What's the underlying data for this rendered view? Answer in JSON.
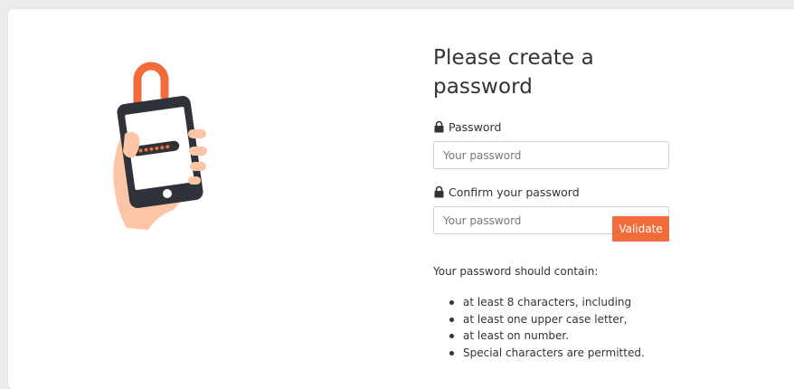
{
  "form": {
    "title": "Please create a password",
    "password_label": "Password",
    "password_placeholder": "Your password",
    "password_value": "",
    "confirm_label": "Confirm your password",
    "confirm_placeholder": "Your password",
    "confirm_value": "",
    "validate_label": "Validate",
    "lock_icon": "lock-icon"
  },
  "requirements": {
    "intro": "Your password should contain:",
    "items": [
      "at least 8 characters, including",
      "at least one upper case letter,",
      "at least on number.",
      "Special characters are permitted."
    ]
  },
  "illustration": {
    "icon": "phone-with-open-padlock-illustration"
  },
  "colors": {
    "accent": "#f26b3a",
    "text": "#333333",
    "page_background": "#ececec",
    "card_background": "#ffffff",
    "input_border": "#cfcfcf",
    "phone_body": "#2f3238",
    "skin": "#fbc5a6"
  }
}
